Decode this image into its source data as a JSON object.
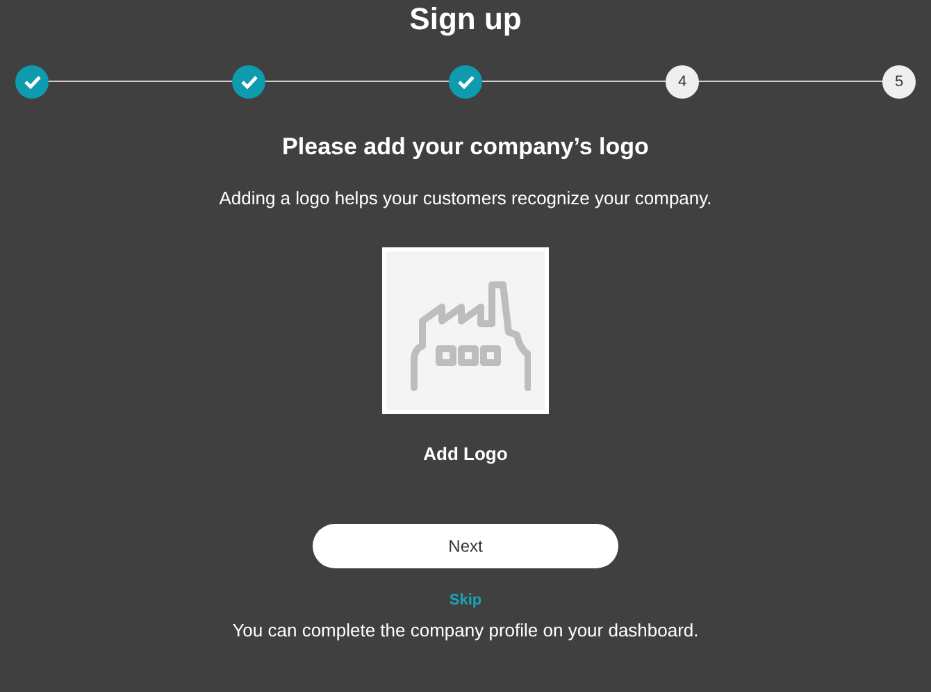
{
  "title": "Sign up",
  "steps": [
    {
      "completed": true
    },
    {
      "completed": true
    },
    {
      "completed": true
    },
    {
      "completed": false,
      "label": "4"
    },
    {
      "completed": false,
      "label": "5"
    }
  ],
  "heading": "Please add your company’s logo",
  "description": "Adding a logo helps your customers recognize your company.",
  "logo_label": "Add Logo",
  "next_button": "Next",
  "skip_link": "Skip",
  "footer_note": "You can complete the company profile on your dashboard."
}
